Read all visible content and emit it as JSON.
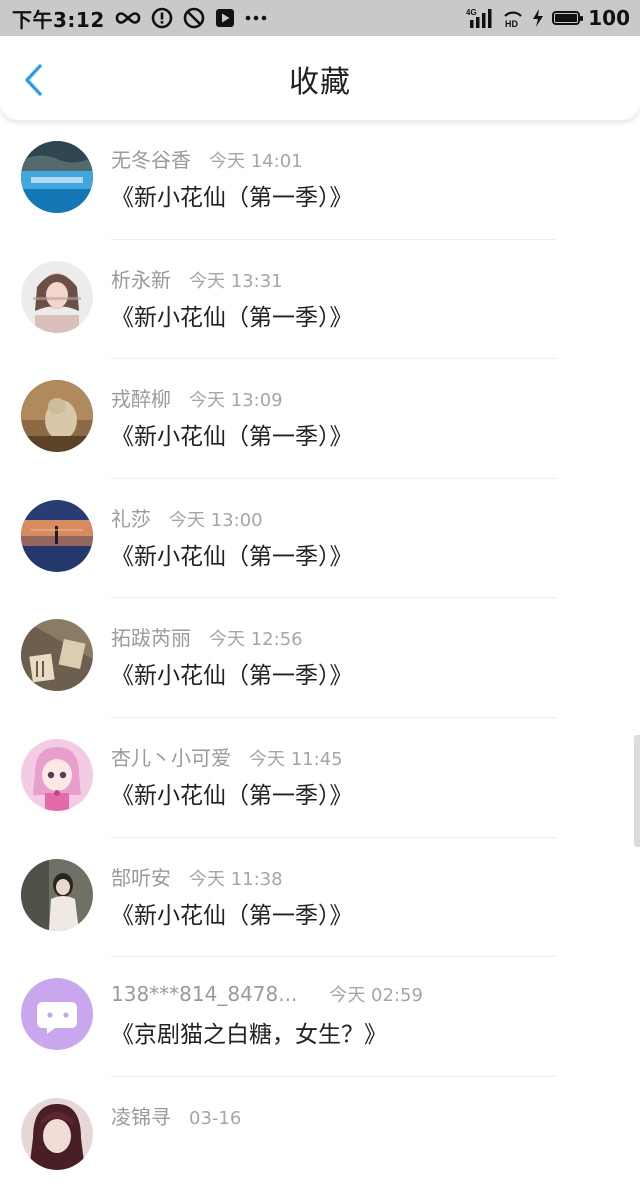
{
  "status_bar": {
    "time": "下午3:12",
    "network": "4G",
    "hd": "HD",
    "battery": "100",
    "icons": [
      "infinity-icon",
      "alert-circle-icon",
      "blocked-icon",
      "play-box-icon",
      "more-dots-icon",
      "signal-icon",
      "hd-icon",
      "charging-icon",
      "battery-icon"
    ]
  },
  "header": {
    "title": "收藏",
    "back_icon": "chevron-left-icon"
  },
  "accent_color": "#2f9bf0",
  "items": [
    {
      "username": "无冬谷香",
      "time": "今天 14:01",
      "title": "《新小花仙（第一季）》"
    },
    {
      "username": "析永新",
      "time": "今天 13:31",
      "title": "《新小花仙（第一季）》"
    },
    {
      "username": "戎醉柳",
      "time": "今天 13:09",
      "title": "《新小花仙（第一季）》"
    },
    {
      "username": "礼莎",
      "time": "今天 13:00",
      "title": "《新小花仙（第一季）》"
    },
    {
      "username": "拓跋芮丽",
      "time": "今天 12:56",
      "title": "《新小花仙（第一季）》"
    },
    {
      "username": "杏儿丶小可爱",
      "time": "今天 11:45",
      "title": "《新小花仙（第一季）》"
    },
    {
      "username": "郜听安",
      "time": "今天 11:38",
      "title": "《新小花仙（第一季）》"
    },
    {
      "username": "138***814_8478...",
      "time": "今天 02:59",
      "title": "《京剧猫之白糖，女生？》"
    },
    {
      "username": "凌锦寻",
      "time": "03-16",
      "title": ""
    }
  ]
}
